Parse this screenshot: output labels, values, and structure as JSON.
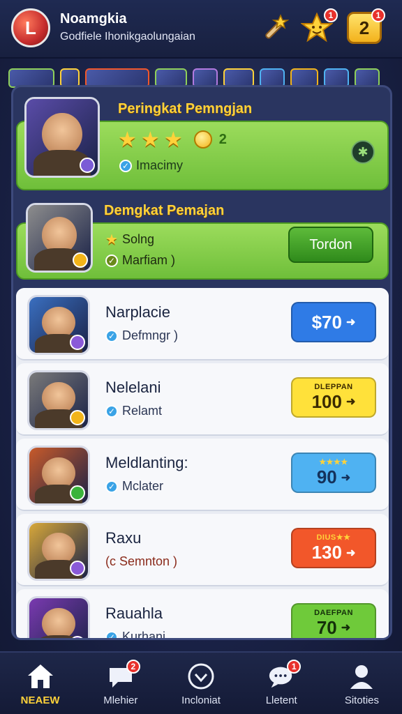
{
  "app": {
    "title": "Noamgkia",
    "subtitle": "Godfiele Ihonikgaolungaian",
    "logo_glyph": "L",
    "star_badge": "1",
    "level_value": "2",
    "level_badge": "1"
  },
  "featured": [
    {
      "title": "Peringkat Pemngjan",
      "stars": [
        "★",
        "★",
        "★"
      ],
      "coin_count": "2",
      "check_label": "Imacimy",
      "colors": {
        "portrait": "#5a4ca8",
        "corner": "#7b5cd6"
      }
    },
    {
      "title": "Demgkat Pemajan",
      "line1": "Solng",
      "line2": "Marfiam )",
      "button_label": "Tordon",
      "colors": {
        "portrait": "#8d8d8d",
        "corner": "#f2b41a"
      }
    }
  ],
  "list": [
    {
      "name": "Narplacie",
      "sub": "Defmngr )",
      "price": "$70",
      "tag": "",
      "color": "#2f7be6",
      "text_color": "#ffffff",
      "portrait": "#3a6fc0",
      "corner": "#8a5ad8"
    },
    {
      "name": "Nelelani",
      "sub": "Relamt",
      "price": "100",
      "tag": "DLEPPAN",
      "color": "#ffe13a",
      "text_color": "#3b2a00",
      "portrait": "#7a7a7a",
      "corner": "#f2b41a"
    },
    {
      "name": "Meldlanting:",
      "sub": "Mclater",
      "price": "90",
      "tag": "★★★★",
      "color": "#4fb2f2",
      "text_color": "#14325c",
      "portrait": "#c85a2a",
      "corner": "#3ab33a"
    },
    {
      "name": "Raxu",
      "sub": "(c Semnton )",
      "price": "130",
      "tag": "DIUS★★",
      "color": "#f2572a",
      "text_color": "#ffffff",
      "portrait": "#d8a83a",
      "corner": "#8a5ad8"
    },
    {
      "name": "Rauahla",
      "sub": "Kurhani",
      "price": "70",
      "tag": "DAEFPAN",
      "color": "#6fca3a",
      "text_color": "#14300a",
      "portrait": "#7a3ab0",
      "corner": "#8a5ad8"
    }
  ],
  "nav": [
    {
      "label": "NEAEW",
      "icon": "home-icon",
      "active": true
    },
    {
      "label": "Mlehier",
      "icon": "chat-icon",
      "badge": "2"
    },
    {
      "label": "Incloniat",
      "icon": "compass-icon"
    },
    {
      "label": "Lletent",
      "icon": "chat-bubbles-icon",
      "badge": "1"
    },
    {
      "label": "Sitoties",
      "icon": "user-icon"
    }
  ]
}
